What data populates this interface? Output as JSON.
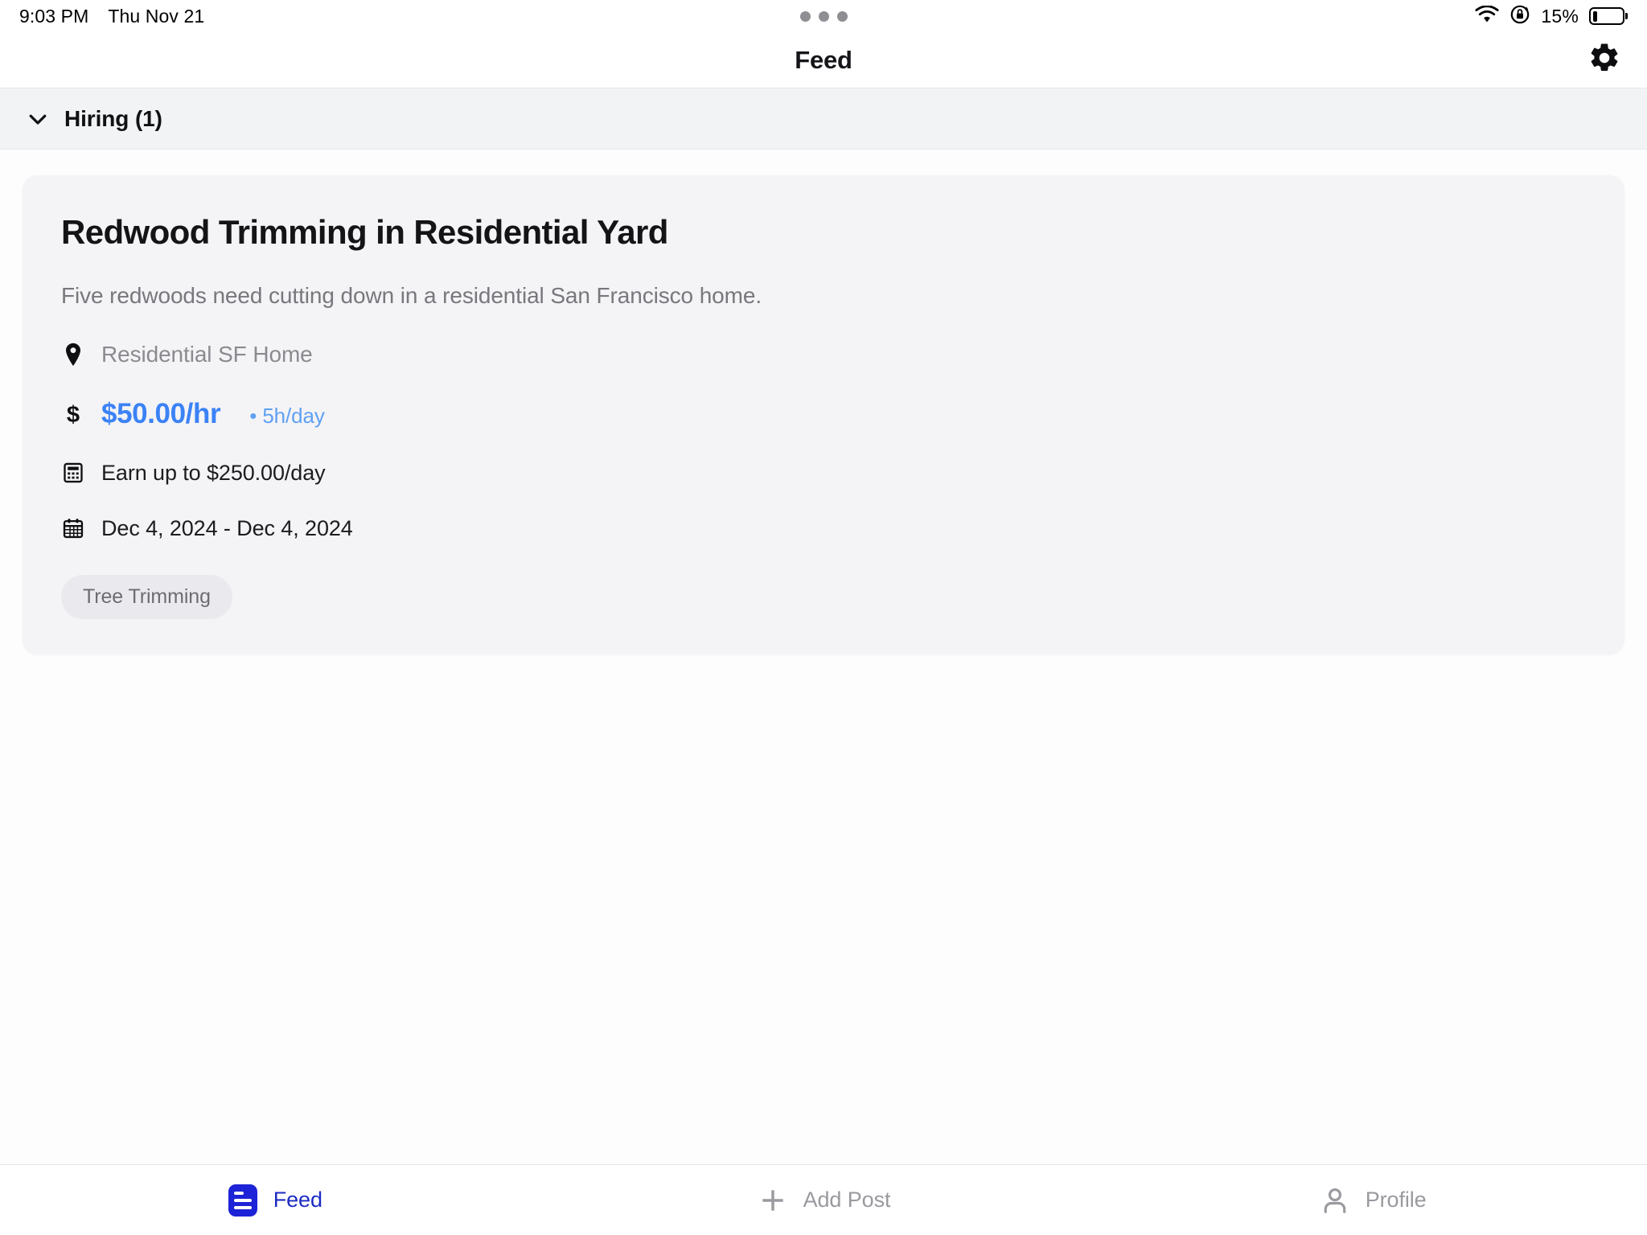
{
  "status_bar": {
    "time": "9:03 PM",
    "date": "Thu Nov 21",
    "battery_percent": "15%",
    "battery_level_fraction": 0.15,
    "icons": [
      "wifi-icon",
      "rotation-lock-icon",
      "battery-icon",
      "multitask-dots-icon"
    ]
  },
  "nav": {
    "title": "Feed",
    "settings_icon": "gear-icon"
  },
  "section": {
    "label": "Hiring (1)",
    "chevron_icon": "chevron-down-icon",
    "expanded": true
  },
  "job": {
    "title": "Redwood Trimming in Residential Yard",
    "description": "Five redwoods need cutting down in a residential San Francisco home.",
    "location_icon": "map-pin-icon",
    "location": "Residential SF Home",
    "pay_icon": "dollar-sign-icon",
    "pay_rate": "$50.00/hr",
    "pay_hours": "• 5h/day",
    "earnings_icon": "calculator-icon",
    "earnings": "Earn up to $250.00/day",
    "date_icon": "calendar-icon",
    "date_range": "Dec 4, 2024 - Dec 4, 2024",
    "tags": [
      "Tree Trimming"
    ]
  },
  "tabs": [
    {
      "label": "Feed",
      "icon": "feed-document-icon",
      "active": true
    },
    {
      "label": "Add Post",
      "icon": "plus-icon",
      "active": false
    },
    {
      "label": "Profile",
      "icon": "person-icon",
      "active": false
    }
  ],
  "colors": {
    "accent_blue": "#3b82f6",
    "tab_active_blue": "#1d23d6",
    "card_bg": "#f4f4f6",
    "section_bg": "#f2f3f5",
    "muted_text": "#8a8a90"
  }
}
